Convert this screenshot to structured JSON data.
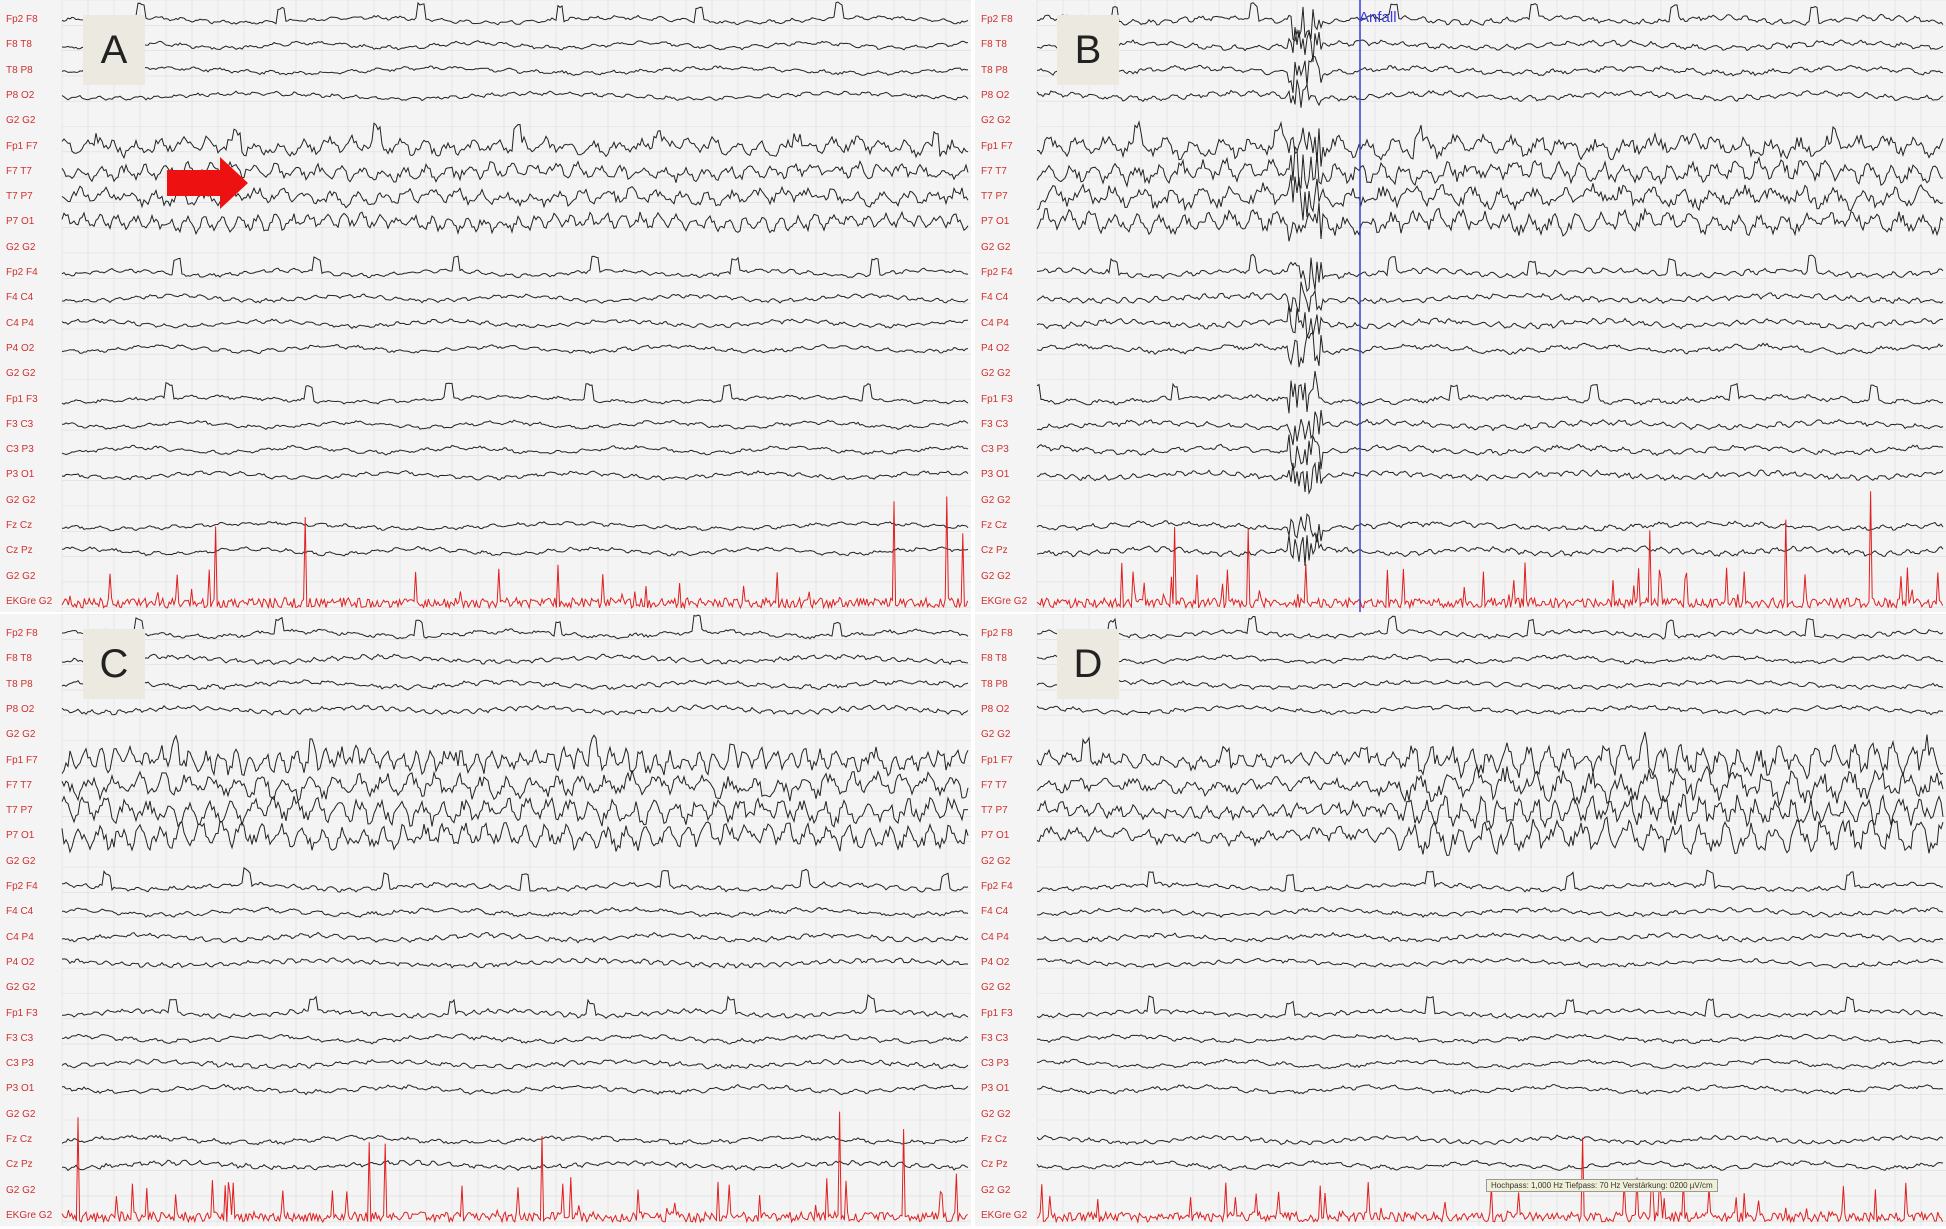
{
  "channel_labels": [
    "Fp2 F8",
    "F8 T8",
    "T8 P8",
    "P8 O2",
    "G2 G2",
    "Fp1 F7",
    "F7 T7",
    "T7 P7",
    "P7 O1",
    "G2 G2",
    "Fp2 F4",
    "F4 C4",
    "C4 P4",
    "P4 O2",
    "G2 G2",
    "Fp1 F3",
    "F3 C3",
    "C3 P3",
    "P3 O1",
    "G2 G2",
    "Fz Cz",
    "Cz Pz",
    "G2 G2",
    "EKGre G2"
  ],
  "panels": [
    {
      "letter": "A",
      "has_arrow": true
    },
    {
      "letter": "B",
      "marker_label": "Anfall"
    },
    {
      "letter": "C"
    },
    {
      "letter": "D",
      "filter_text": "Hochpass: 1,000 Hz   Tiefpass: 70 Hz   Verstärkung: 0200 µV/cm"
    }
  ],
  "colors": {
    "trace": "#222222",
    "ekg": "#e02020",
    "label": "#d03030",
    "grid": "#dcdcdc",
    "marker": "#3a3ad8",
    "arrow": "#ee1111",
    "panel_bg": "#f4f4f4"
  }
}
